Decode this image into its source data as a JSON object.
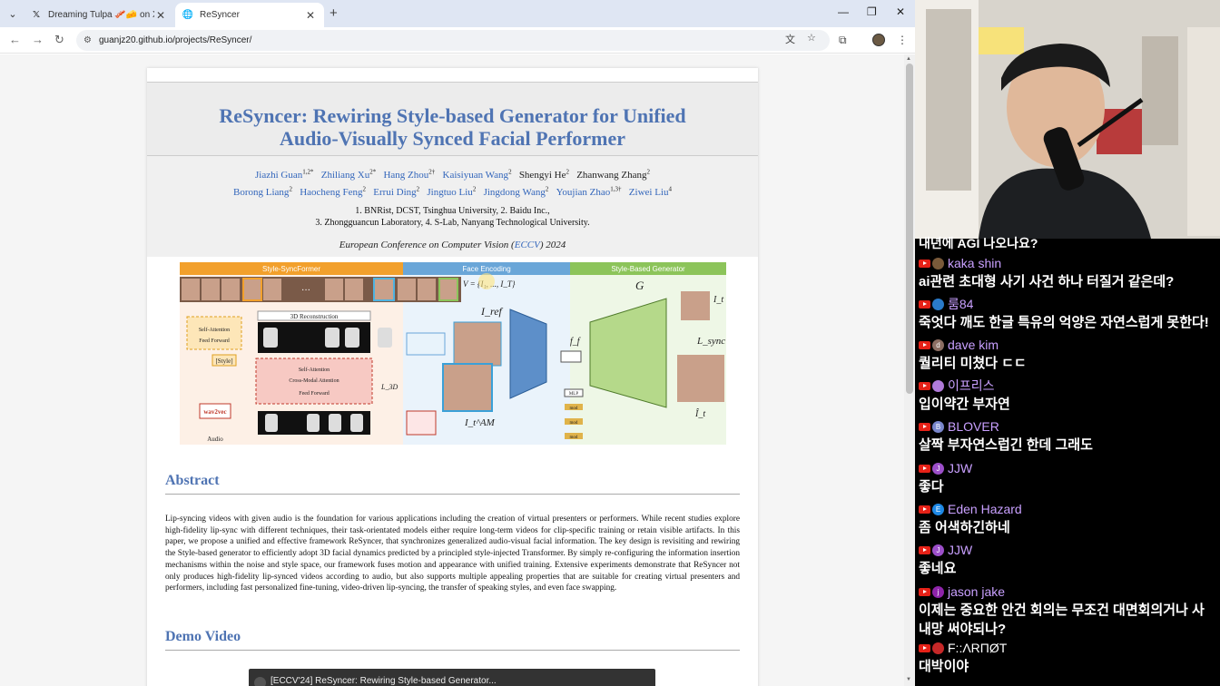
{
  "browser": {
    "tabs": [
      {
        "title": "Dreaming Tulpa 🥓🧀 on X",
        "favicon": "x-icon",
        "active": false
      },
      {
        "title": "ReSyncer",
        "favicon": "globe-icon",
        "active": true
      }
    ],
    "url": "guanjz20.github.io/projects/ReSyncer/"
  },
  "paper": {
    "title_line1": "ReSyncer: Rewiring Style-based Generator for Unified",
    "title_line2": "Audio-Visually Synced Facial Performer",
    "authors_row1": [
      {
        "name": "Jiazhi Guan",
        "sup": "1,2*",
        "link": true
      },
      {
        "name": "Zhiliang Xu",
        "sup": "2*",
        "link": true
      },
      {
        "name": "Hang Zhou",
        "sup": "2†",
        "link": true
      },
      {
        "name": "Kaisiyuan Wang",
        "sup": "2",
        "link": true
      },
      {
        "name": "Shengyi He",
        "sup": "2",
        "link": false
      },
      {
        "name": "Zhanwang Zhang",
        "sup": "2",
        "link": false
      }
    ],
    "authors_row2": [
      {
        "name": "Borong Liang",
        "sup": "2",
        "link": true
      },
      {
        "name": "Haocheng Feng",
        "sup": "2",
        "link": true
      },
      {
        "name": "Errui Ding",
        "sup": "2",
        "link": true
      },
      {
        "name": "Jingtuo Liu",
        "sup": "2",
        "link": true
      },
      {
        "name": "Jingdong Wang",
        "sup": "2",
        "link": true
      },
      {
        "name": "Youjian Zhao",
        "sup": "1,3†",
        "link": true
      },
      {
        "name": "Ziwei Liu",
        "sup": "4",
        "link": true
      }
    ],
    "affil_line1": "1. BNRist, DCST, Tsinghua University,   2. Baidu Inc.,",
    "affil_line2": "3. Zhongguancun Laboratory,   4. S-Lab, Nanyang Technological University.",
    "venue_prefix": "European Conference on Computer Vision (",
    "venue_link": "ECCV",
    "venue_suffix": ") 2024",
    "figure": {
      "section1": "Style-SyncFormer",
      "section2": "Face Encoding",
      "section3": "Style-Based Generator",
      "v_label": "V = {I₁, ..., I_T}",
      "g_label": "G",
      "recon_label": "3D Reconstruction",
      "self_attn": "Self-Attention",
      "feed_fwd": "Feed Forward",
      "style_label": "[Style]",
      "cross_attn": "Cross-Modal Attention",
      "wav2vec": "wav2vec",
      "audio": "Audio",
      "iref": "I_ref",
      "iam": "I_t^AM",
      "ff": "f_f",
      "mlp": "MLP",
      "mod": "mod",
      "lsync": "L_sync",
      "l3d": "L_3D",
      "it": "I_t",
      "ithat": "Î_t"
    },
    "abstract_heading": "Abstract",
    "abstract_text": "Lip-syncing videos with given audio is the foundation for various applications including the creation of virtual presenters or performers. While recent studies explore high-fidelity lip-sync with different techniques, their task-orientated models either require long-term videos for clip-specific training or retain visible artifacts. In this paper, we propose a unified and effective framework ReSyncer, that synchronizes generalized audio-visual facial information. The key design is revisiting and rewiring the Style-based generator to efficiently adopt 3D facial dynamics predicted by a principled style-injected Transformer. By simply re-configuring the information insertion mechanisms within the noise and style space, our framework fuses motion and appearance with unified training. Extensive experiments demonstrate that ReSyncer not only produces high-fidelity lip-synced videos according to audio, but also supports multiple appealing properties that are suitable for creating virtual presenters and performers, including fast personalized fine-tuning, video-driven lip-syncing, the transfer of speaking styles, and even face swapping.",
    "demo_heading": "Demo Video",
    "video_title": "[ECCV'24] ReSyncer: Rewiring Style-based Generator..."
  },
  "chat": {
    "top_partial": "내년에 AGI 나오나요?",
    "messages": [
      {
        "user": "kaka shin",
        "color": "#c9a0ff",
        "avatar_color": "#7a5a3a",
        "avatar_letter": "",
        "text": "ai관련 초대형 사기 사건 하나 터질거 같은데?"
      },
      {
        "user": "룸84",
        "color": "#c9a0ff",
        "avatar_color": "#2a7ac9",
        "avatar_letter": "",
        "text": "죽엇다 깨도 한글 특유의 억양은 자연스럽게 못한다!"
      },
      {
        "user": "dave kim",
        "color": "#c9a0ff",
        "avatar_color": "#8d6e63",
        "avatar_letter": "d",
        "text": "퀄리티 미쳤다 ㄷㄷ"
      },
      {
        "user": "이프리스",
        "color": "#c9a0ff",
        "avatar_color": "#b07ad9",
        "avatar_letter": "",
        "text": "입이약간 부자연"
      },
      {
        "user": "BLOVER",
        "color": "#c9a0ff",
        "avatar_color": "#7986cb",
        "avatar_letter": "B",
        "text": "살짝 부자연스럽긴 한데 그래도"
      },
      {
        "user": "JJW",
        "color": "#c9a0ff",
        "avatar_color": "#9c4fc9",
        "avatar_letter": "J",
        "text": "좋다"
      },
      {
        "user": "Eden Hazard",
        "color": "#c9a0ff",
        "avatar_color": "#1e88e5",
        "avatar_letter": "E",
        "text": "좀 어색하긴하네"
      },
      {
        "user": "JJW",
        "color": "#c9a0ff",
        "avatar_color": "#9c4fc9",
        "avatar_letter": "J",
        "text": "좋네요"
      },
      {
        "user": "jason jake",
        "color": "#c9a0ff",
        "avatar_color": "#8e24aa",
        "avatar_letter": "j",
        "text": "이제는 중요한 안건 회의는 무조건 대면회의거나 사내망 써야되나?"
      },
      {
        "user": "F::ΛRПØT",
        "color": "#ffffff",
        "avatar_color": "#c62828",
        "avatar_letter": "",
        "text": "대박이야"
      }
    ]
  },
  "colors": {
    "title_blue": "#4f74b3",
    "link_blue": "#3366bb",
    "youtube_red": "#e62117"
  }
}
